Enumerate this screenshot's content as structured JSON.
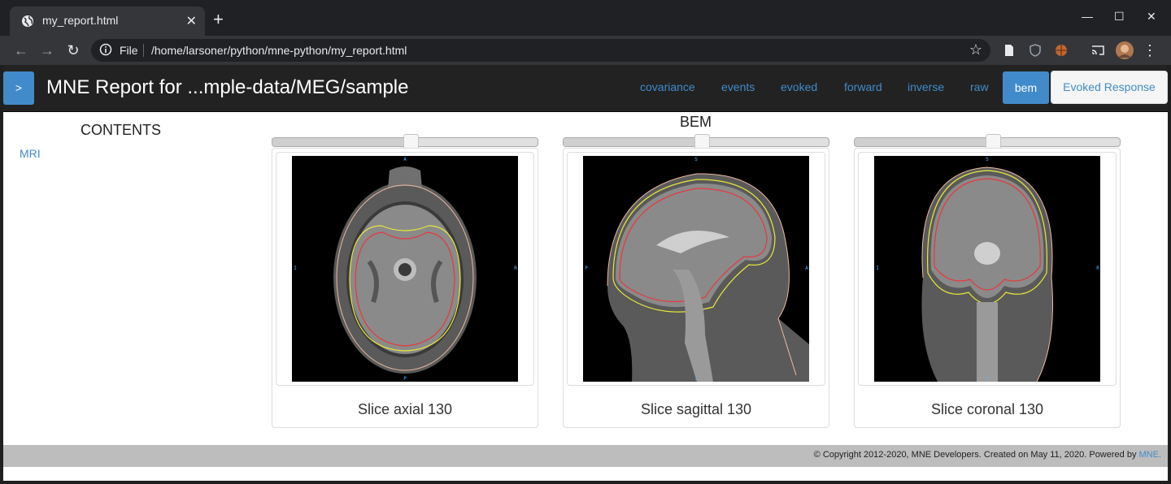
{
  "browser": {
    "tab_title": "my_report.html",
    "scheme_label": "File",
    "url": "/home/larsoner/python/mne-python/my_report.html"
  },
  "report": {
    "toggle_label": ">",
    "brand": "MNE Report for ...mple-data/MEG/sample",
    "nav": [
      "covariance",
      "events",
      "evoked",
      "forward",
      "inverse",
      "raw"
    ],
    "nav_active": "bem",
    "nav_evoked": "Evoked Response",
    "toc_title": "CONTENTS",
    "toc_items": [
      "MRI"
    ],
    "section_title": "BEM",
    "panels": [
      {
        "caption": "Slice axial 130",
        "slider_level": 0.52,
        "view": "axial",
        "orient": {
          "top": "A",
          "bottom": "P",
          "left": "I",
          "right": "R"
        }
      },
      {
        "caption": "Slice sagittal 130",
        "slider_level": 0.52,
        "view": "sagittal",
        "orient": {
          "top": "S",
          "bottom": "I",
          "left": "P",
          "right": "A"
        }
      },
      {
        "caption": "Slice coronal 130",
        "slider_level": 0.52,
        "view": "coronal",
        "orient": {
          "top": "S",
          "bottom": "I",
          "left": "I",
          "right": "R"
        }
      }
    ],
    "footer_text": "© Copyright 2012-2020, MNE Developers. Created on May 11, 2020. Powered by ",
    "footer_link": "MNE."
  },
  "colors": {
    "accent": "#428bca",
    "navbar": "#222222",
    "inner_skull": "#e8383d",
    "outer_skull": "#e8e83a",
    "head": "#f0b9a0"
  }
}
